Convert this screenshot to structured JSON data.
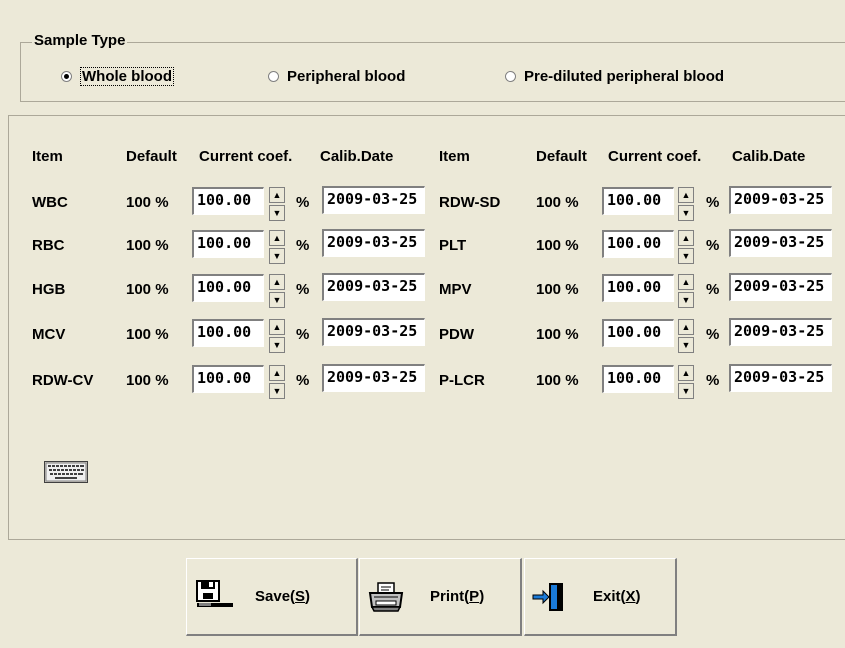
{
  "sample_type": {
    "title": "Sample Type",
    "options": [
      "Whole blood",
      "Peripheral blood",
      "Pre-diluted peripheral blood"
    ],
    "selected": "Whole blood"
  },
  "table": {
    "headers": {
      "item": "Item",
      "default": "Default",
      "coef": "Current coef.",
      "date": "Calib.Date"
    },
    "pct_unit": "%",
    "left": [
      {
        "item": "WBC",
        "default": "100 %",
        "coef": "100.00",
        "date": "2009-03-25"
      },
      {
        "item": "RBC",
        "default": "100 %",
        "coef": "100.00",
        "date": "2009-03-25"
      },
      {
        "item": "HGB",
        "default": "100 %",
        "coef": "100.00",
        "date": "2009-03-25"
      },
      {
        "item": "MCV",
        "default": "100 %",
        "coef": "100.00",
        "date": "2009-03-25"
      },
      {
        "item": "RDW-CV",
        "default": "100 %",
        "coef": "100.00",
        "date": "2009-03-25"
      }
    ],
    "right": [
      {
        "item": "RDW-SD",
        "default": "100 %",
        "coef": "100.00",
        "date": "2009-03-25"
      },
      {
        "item": "PLT",
        "default": "100 %",
        "coef": "100.00",
        "date": "2009-03-25"
      },
      {
        "item": "MPV",
        "default": "100 %",
        "coef": "100.00",
        "date": "2009-03-25"
      },
      {
        "item": "PDW",
        "default": "100 %",
        "coef": "100.00",
        "date": "2009-03-25"
      },
      {
        "item": "P-LCR",
        "default": "100 %",
        "coef": "100.00",
        "date": "2009-03-25"
      }
    ]
  },
  "buttons": {
    "save": {
      "text": "Save(",
      "key": "S",
      "end": ")"
    },
    "print": {
      "text": "Print(",
      "key": "P",
      "end": ")"
    },
    "exit": {
      "text": "Exit(",
      "key": "X",
      "end": ")"
    }
  }
}
